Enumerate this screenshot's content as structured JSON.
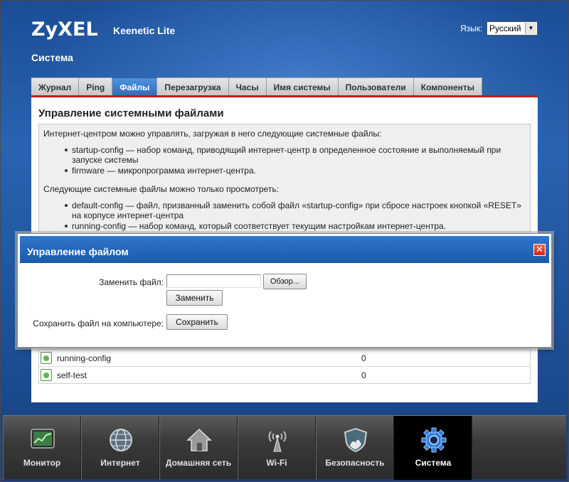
{
  "header": {
    "logo": "ZyXEL",
    "product": "Keenetic Lite",
    "language_label": "Язык:",
    "language_value": "Русский",
    "section_title": "Система"
  },
  "tabs": [
    {
      "label": "Журнал",
      "active": false
    },
    {
      "label": "Ping",
      "active": false
    },
    {
      "label": "Файлы",
      "active": true
    },
    {
      "label": "Перезагрузка",
      "active": false
    },
    {
      "label": "Часы",
      "active": false
    },
    {
      "label": "Имя системы",
      "active": false
    },
    {
      "label": "Пользователи",
      "active": false
    },
    {
      "label": "Компоненты",
      "active": false
    }
  ],
  "content": {
    "title": "Управление системными файлами",
    "intro": "Интернет-центром можно управлять, загружая в него следующие системные файлы:",
    "loadable": [
      "startup-config — набор команд, приводящий интернет-центр в определенное состояние и выполняемый при запуске системы",
      "firmware — микропрограмма интернет-центра."
    ],
    "view_intro": "Следующие системные файлы можно только просмотреть:",
    "viewable": [
      "default-config — файл, призванный заменить собой файл «startup-config» при сбросе настроек кнопкой «RESET» на корпусе интернет-центра",
      "running-config — набор команд, который соответствует текущим настройкам интернет-центра."
    ],
    "files": [
      {
        "name": "running-config",
        "size": "0"
      },
      {
        "name": "self-test",
        "size": "0"
      }
    ]
  },
  "dialog": {
    "title": "Управление файлом",
    "close_symbol": "✕",
    "replace_label": "Заменить файл:",
    "browse_label": "Обзор...",
    "replace_button": "Заменить",
    "save_label": "Сохранить файл на компьютере:",
    "save_button": "Сохранить"
  },
  "dock": [
    {
      "label": "Монитор",
      "icon": "monitor-icon",
      "active": false
    },
    {
      "label": "Интернет",
      "icon": "globe-icon",
      "active": false
    },
    {
      "label": "Домашняя сеть",
      "icon": "home-icon",
      "active": false
    },
    {
      "label": "Wi-Fi",
      "icon": "wifi-antenna-icon",
      "active": false
    },
    {
      "label": "Безопасность",
      "icon": "shield-icon",
      "active": false
    },
    {
      "label": "Система",
      "icon": "gear-icon",
      "active": true
    }
  ],
  "colors": {
    "accent_blue": "#2f6fbd",
    "accent_red": "#c41b1b",
    "background_blue": "#1f559f"
  }
}
